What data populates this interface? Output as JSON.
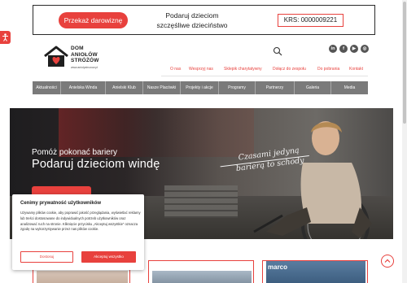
{
  "banner": {
    "donate_label": "Przekaż darowiznę",
    "message": "Podaruj dzieciom szczęśliwe dzieciństwo",
    "krs": "KRS: 0000009221"
  },
  "logo": {
    "line1": "DOM",
    "line2": "ANIOŁÓW",
    "line3": "STRÓŻÓW",
    "url": "www.aniolystrozow.pl"
  },
  "socials": [
    {
      "label": "in",
      "icon": "linkedin-icon"
    },
    {
      "label": "f",
      "icon": "facebook-icon"
    },
    {
      "label": "▶",
      "icon": "youtube-icon"
    },
    {
      "label": "◎",
      "icon": "instagram-icon"
    }
  ],
  "nav_upper": [
    "O nas",
    "Wesprzyj nas",
    "Sklepik charytatywny",
    "Dołącz do zespołu",
    "Do pobrania",
    "Kontakt"
  ],
  "nav_main": [
    "Aktualności",
    "Anielska Winda",
    "Anielski Klub",
    "Nasze Placówki",
    "Projekty i akcje",
    "Programy",
    "Partnerzy",
    "Galeria",
    "Media"
  ],
  "hero": {
    "subtitle": "Pomóż pokonać bariery",
    "title": "Podaruj dzieciom windę",
    "script_line1": "Czasami jedyną",
    "script_line2": "barierą to schody"
  },
  "cards": [
    {
      "label": ""
    },
    {
      "label": ""
    },
    {
      "label": "marco"
    }
  ],
  "cookie": {
    "title": "Cenimy prywatność użytkowników",
    "body": "Używamy plików cookie, aby poprawić jakość przeglądania, wyświetlać reklamy lub treści dostosowane do indywidualnych potrzeb użytkowników oraz analizować ruch na stronie. Kliknięcie przycisku „Akceptuj wszystkie” oznacza zgodę na wykorzystywanie przez nas plików cookie.",
    "customize_label": "Dostosuj",
    "accept_label": "Akceptuj wszystko"
  },
  "colors": {
    "accent": "#e8413d",
    "nav_bg": "#7a7a7a"
  }
}
